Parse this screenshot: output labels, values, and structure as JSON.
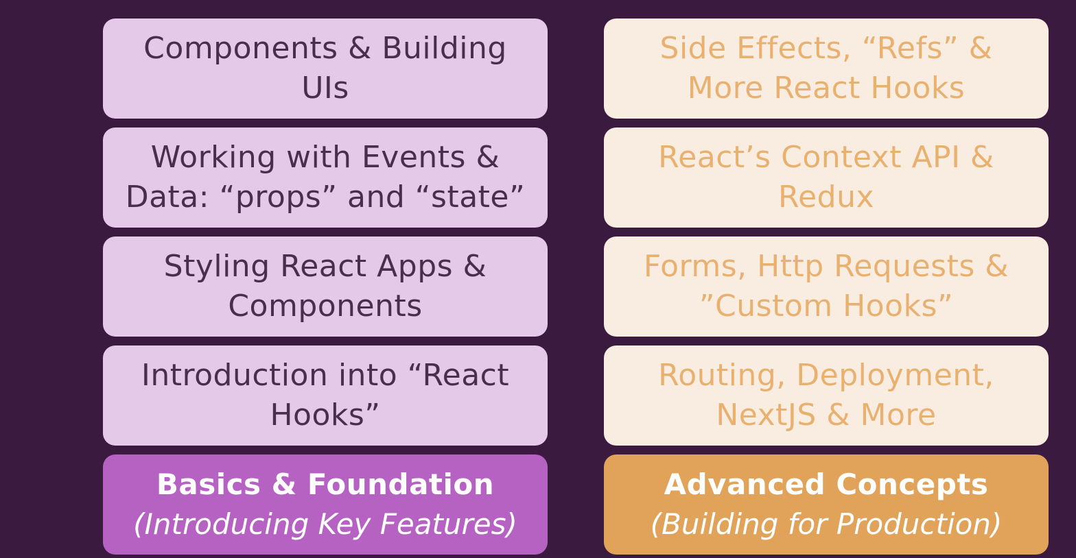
{
  "colors": {
    "background": "#3b1a40",
    "basics_card": "#e4c9e8",
    "basics_text": "#4a2e4e",
    "basics_header": "#b562c2",
    "advanced_card": "#f9ece0",
    "advanced_text": "#e8b170",
    "advanced_header": "#e0a359"
  },
  "basics": {
    "items": [
      "Components & Building UIs",
      "Working with Events & Data: “props” and “state”",
      "Styling React Apps & Components",
      "Introduction into “React Hooks”"
    ],
    "title": "Basics & Foundation",
    "subtitle": "(Introducing Key Features)"
  },
  "advanced": {
    "items": [
      "Side Effects, “Refs” & More React Hooks",
      "React’s Context API & Redux",
      "Forms, Http Requests & ”Custom Hooks”",
      "Routing, Deployment, NextJS &  More"
    ],
    "title": "Advanced Concepts",
    "subtitle": "(Building for Production)"
  }
}
